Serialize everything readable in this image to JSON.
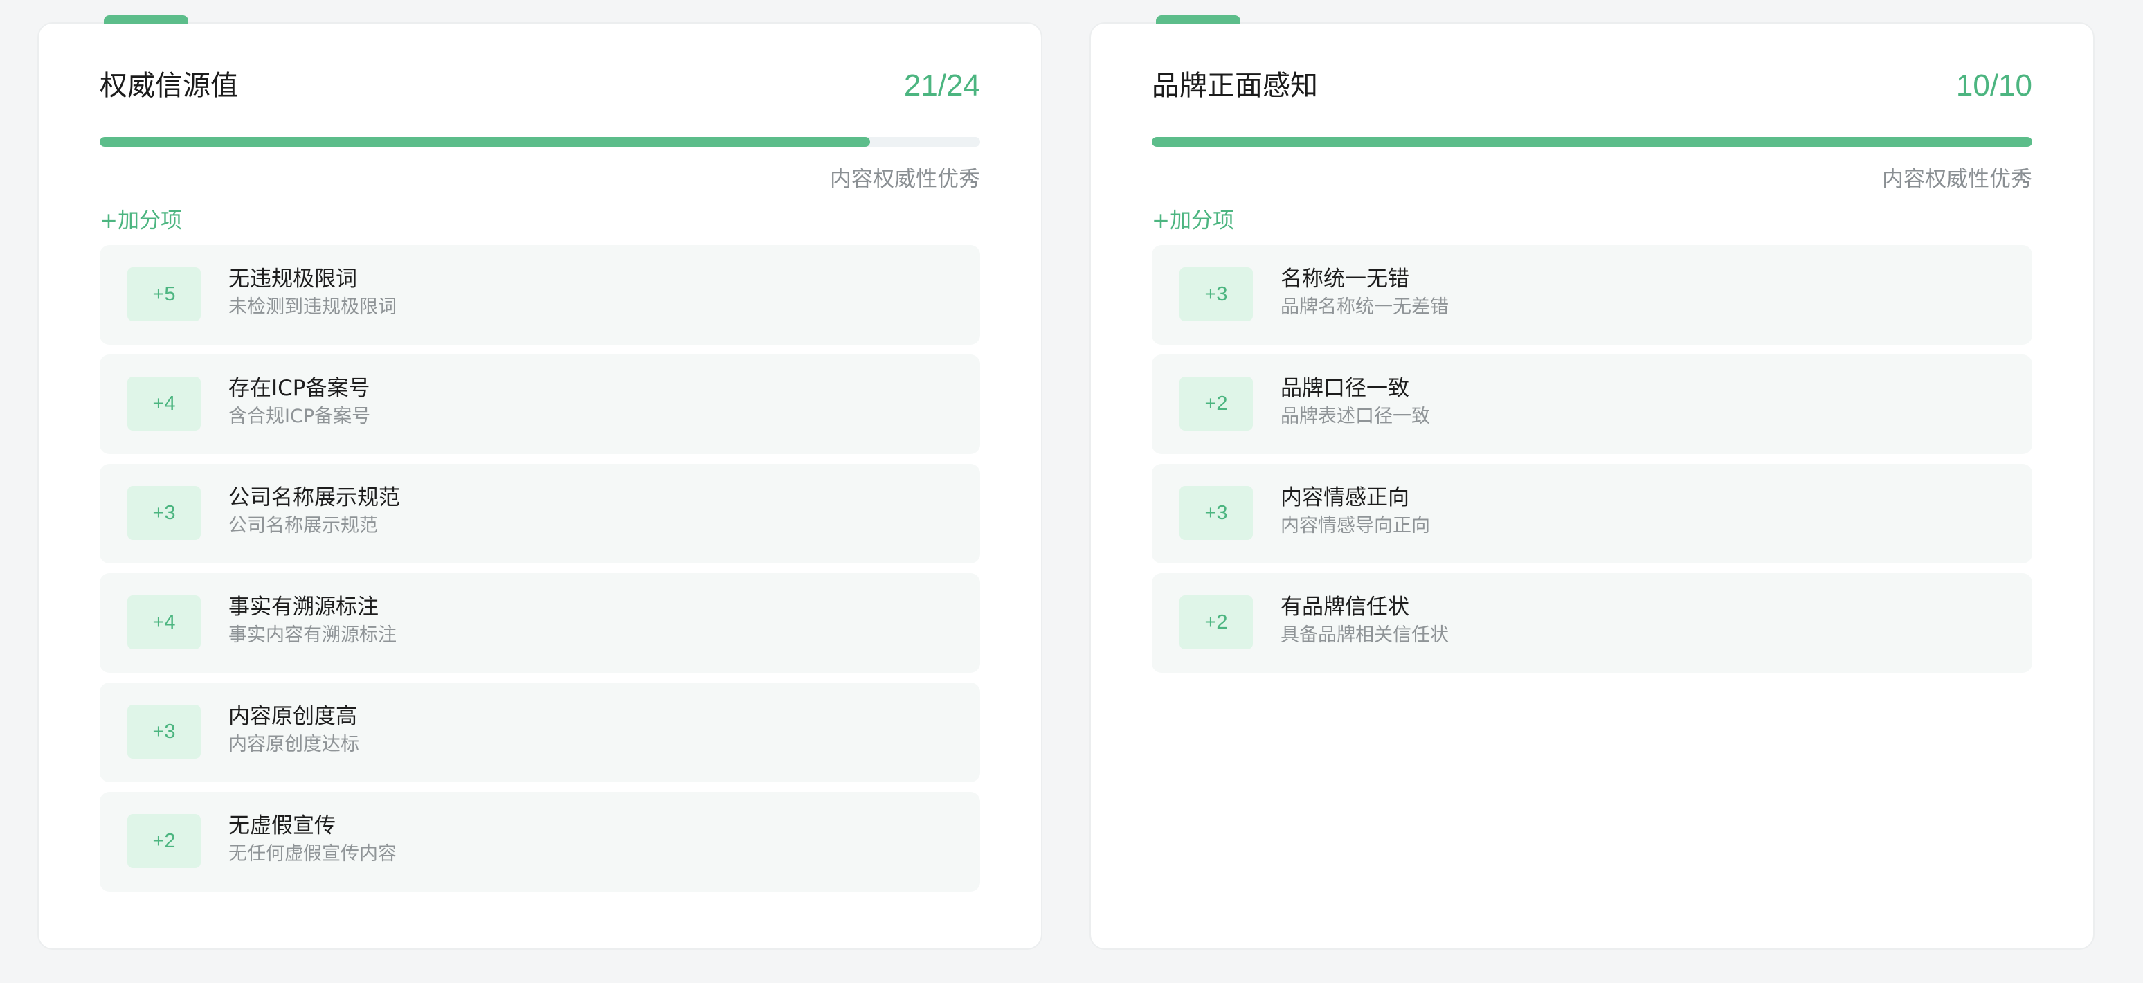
{
  "cards": [
    {
      "title": "权威信源值",
      "score": "21/24",
      "progress": 0.875,
      "status": "内容权威性优秀",
      "bonus_label": "+加分项",
      "items": [
        {
          "points": "+5",
          "name": "无违规极限词",
          "desc": "未检测到违规极限词"
        },
        {
          "points": "+4",
          "name": "存在ICP备案号",
          "desc": "含合规ICP备案号"
        },
        {
          "points": "+3",
          "name": "公司名称展示规范",
          "desc": "公司名称展示规范"
        },
        {
          "points": "+4",
          "name": "事实有溯源标注",
          "desc": "事实内容有溯源标注"
        },
        {
          "points": "+3",
          "name": "内容原创度高",
          "desc": "内容原创度达标"
        },
        {
          "points": "+2",
          "name": "无虚假宣传",
          "desc": "无任何虚假宣传内容"
        }
      ]
    },
    {
      "title": "品牌正面感知",
      "score": "10/10",
      "progress": 1.0,
      "status": "内容权威性优秀",
      "bonus_label": "+加分项",
      "items": [
        {
          "points": "+3",
          "name": "名称统一无错",
          "desc": "品牌名称统一无差错"
        },
        {
          "points": "+2",
          "name": "品牌口径一致",
          "desc": "品牌表述口径一致"
        },
        {
          "points": "+3",
          "name": "内容情感正向",
          "desc": "内容情感导向正向"
        },
        {
          "points": "+2",
          "name": "有品牌信任状",
          "desc": "具备品牌相关信任状"
        }
      ]
    }
  ],
  "colors": {
    "accent": "#5cbd8a",
    "accent_text": "#4cb580",
    "badge_bg": "#dff5e8",
    "item_bg": "#f5f8f7",
    "track": "#eef2f4"
  }
}
